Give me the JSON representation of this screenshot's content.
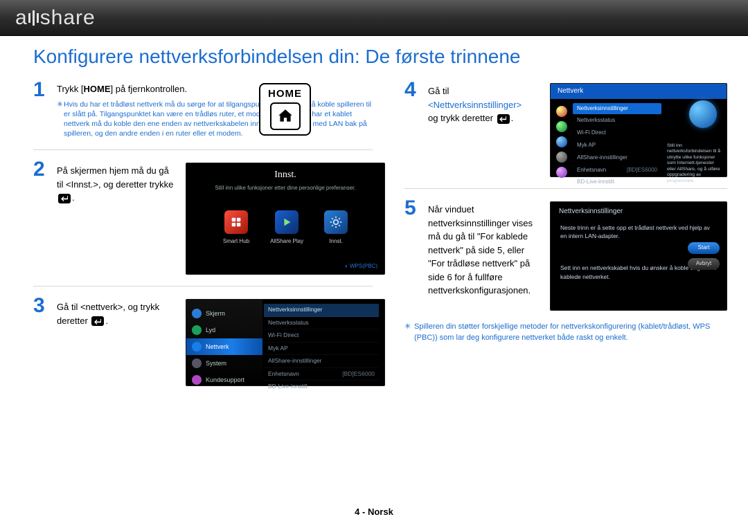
{
  "brand": "allshare",
  "title": "Konfigurere nettverksforbindelsen din: De første trinnene",
  "footer": "4 - Norsk",
  "steps": {
    "s1": {
      "num": "1",
      "text_a": "Trykk [",
      "text_b": "HOME",
      "text_c": "] på fjernkontrollen.",
      "note": "Hvis du har et trådløst nettverk må du sørge for at tilgangspunktet du ønsker å koble spilleren til er slått på. Tilgangspunktet kan være en trådløs ruter, et modem el.l. Hvis du har et kablet nettverk må du koble den ene enden av nettverkskabelen inn i porten merket med LAN bak på spilleren, og den andre enden i en ruter eller et modem.",
      "home_label": "HOME"
    },
    "s2": {
      "num": "2",
      "text": "På skjermen hjem må du gå til <Innst.>, og deretter trykke",
      "tv_title": "Innst.",
      "tv_sub": "Still inn ulike funksjoner etter dine personlige preferanser.",
      "hub1": "Smart Hub",
      "hub2": "AllShare Play",
      "hub3": "Innst.",
      "wps": "◐ WPS(PBC)"
    },
    "s3": {
      "num": "3",
      "text": "Gå til <nettverk>, og trykk deretter",
      "left": [
        "Skjerm",
        "Lyd",
        "Nettverk",
        "System",
        "Kundesupport"
      ],
      "right": [
        "Nettverksinnstillinger",
        "Nettverksstatus",
        "Wi-Fi Direct",
        "Myk AP",
        "AllShare-innstillinger",
        "Enhetsnavn",
        "BD-Live-innstill."
      ],
      "right_val": "[BD]ES6000"
    },
    "s4": {
      "num": "4",
      "text_a": "Gå til",
      "text_b": "<Nettverksinnstillinger>",
      "text_c": "og trykk deretter",
      "hdr": "Nettverk",
      "rows": [
        "Nettverksinnstillinger",
        "Nettverksstatus",
        "Wi-Fi Direct",
        "Myk AP",
        "AllShare-innstillinger",
        "Enhetsnavn",
        "BD-Live-innstill."
      ],
      "row_val": "[BD]ES6000",
      "info": "Still inn nettverksforbindelsen til å utnytte ulike funksjoner som Internett-tjenester eller AllShare, og å utføre oppgradering av programvare."
    },
    "s5": {
      "num": "5",
      "text": "Når vinduet nettverksinnstillinger vises må du gå til \"For kablede nettverk\" på side 5, eller \"For trådløse nettverk\" på side 6 for å fullføre nettverkskonfigurasjonen.",
      "hdr": "Nettverksinnstillinger",
      "body1": "Neste trinn er å sette opp et trådløst nettverk ved hjelp av en intern LAN-adapter.",
      "body2": "Sett inn en nettverkskabel hvis du ønsker å koble deg til det kablede nettverket.",
      "btn_start": "Start",
      "btn_cancel": "Avbryt"
    },
    "footnote": "Spilleren din støtter forskjellige metoder for nettverkskonfigurering (kablet/trådløst, WPS (PBC)) som lar deg konfigurere nettverket både raskt og enkelt."
  }
}
